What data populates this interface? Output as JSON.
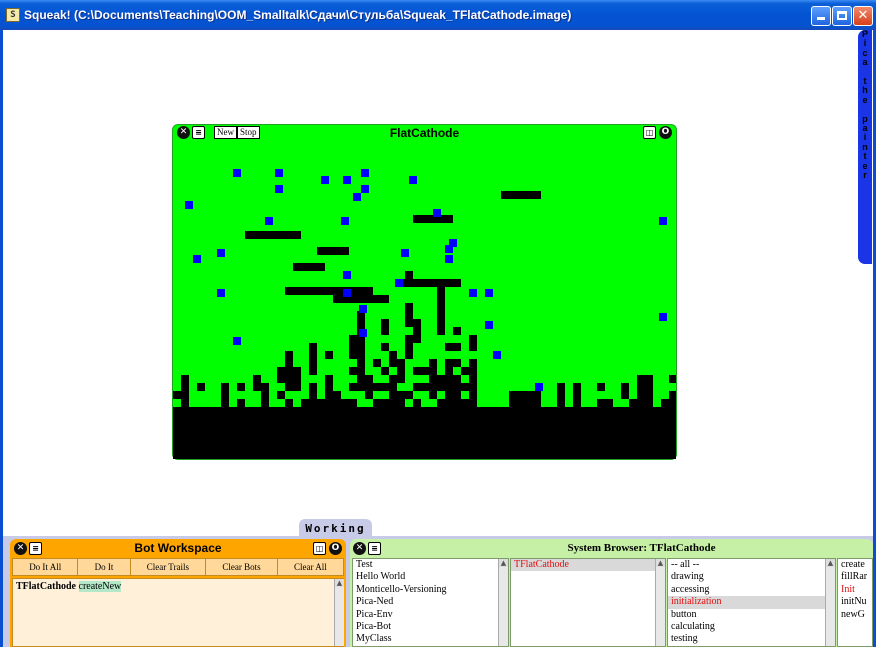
{
  "window": {
    "title": "Squeak! (C:\\Documents\\Teaching\\OOM_Smalltalk\\Сдачи\\Стульба\\Squeak_TFlatCathode.image)",
    "app_icon": "squeak-icon",
    "controls": [
      "minimize-icon",
      "maximize-icon",
      "close-icon"
    ]
  },
  "right_flap": {
    "label": "Pica the painter"
  },
  "flat_cathode": {
    "title": "FlatCathode",
    "buttons": {
      "new": "New",
      "stop": "Stop"
    },
    "colors": {
      "background": "#00ff00",
      "bots": "#0000ff",
      "trails": "#000000"
    }
  },
  "bottom_flap": {
    "label": "Working"
  },
  "bot_workspace": {
    "title": "Bot Workspace",
    "buttons": [
      "Do It All",
      "Do It",
      "Clear Trails",
      "Clear Bots",
      "Clear All"
    ],
    "code": {
      "receiver": "TFlatCathode",
      "message": "createNew"
    }
  },
  "system_browser": {
    "title": "System Browser: TFlatCathode",
    "categories": [
      "Test",
      "Hello World",
      "Monticello-Versioning",
      "Pica-Ned",
      "Pica-Env",
      "Pica-Bot",
      "MyClass"
    ],
    "classes": [
      "TFlatCathode"
    ],
    "protocols": [
      "-- all --",
      "drawing",
      "accessing",
      "initialization",
      "button",
      "calculating",
      "testing"
    ],
    "selected_protocol": "initialization",
    "methods": [
      "create",
      "fillRar",
      "Init",
      "initNu",
      "newG"
    ],
    "selected_method": "Init"
  }
}
